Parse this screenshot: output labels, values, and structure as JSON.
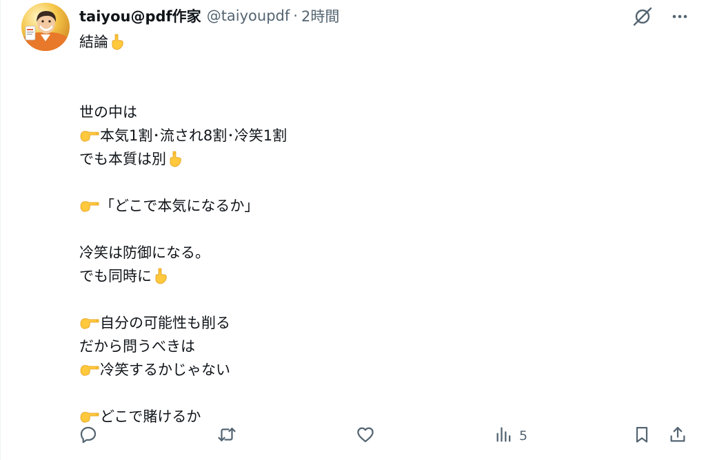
{
  "tweet": {
    "author": {
      "display_name": "taiyou@pdf作家",
      "handle": "@taiyoupdf",
      "separator": "·",
      "time": "2時間"
    },
    "lines": [
      {
        "text": "結論",
        "emoji_after": "pointing-down"
      },
      {
        "blank": true
      },
      {
        "blank": true
      },
      {
        "text": "世の中は"
      },
      {
        "emoji_before": "pointing-right",
        "text": "本気1割･流され8割･冷笑1割"
      },
      {
        "text": "でも本質は別",
        "emoji_after": "pointing-down"
      },
      {
        "blank": true
      },
      {
        "emoji_before": "pointing-right",
        "text": "「どこで本気になるか」"
      },
      {
        "blank": true
      },
      {
        "text": "冷笑は防御になる。"
      },
      {
        "text": "でも同時に",
        "emoji_after": "pointing-down"
      },
      {
        "blank": true
      },
      {
        "emoji_before": "pointing-right",
        "text": "自分の可能性も削る"
      },
      {
        "text": "だから問うべきは"
      },
      {
        "emoji_before": "pointing-right",
        "text": "冷笑するかじゃない"
      },
      {
        "blank": true
      },
      {
        "emoji_before": "pointing-right",
        "text": "どこで賭けるか"
      }
    ],
    "actions": {
      "reply_icon": "reply-icon",
      "retweet_icon": "retweet-icon",
      "like_icon": "like-icon",
      "views_icon": "views-icon",
      "views_count": "5",
      "bookmark_icon": "bookmark-icon",
      "share_icon": "share-icon"
    },
    "top_icons": [
      "grok-icon",
      "more-icon"
    ]
  },
  "colors": {
    "text": "#0f1419",
    "secondary": "#536471",
    "emoji_yellow": "#FFC83D"
  }
}
